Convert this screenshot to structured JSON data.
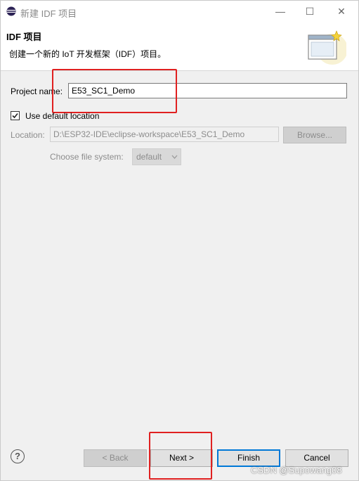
{
  "window": {
    "title": "新建 IDF 项目",
    "controls": {
      "minimize": "—",
      "maximize": "☐",
      "close": "✕"
    }
  },
  "header": {
    "title": "IDF 项目",
    "description": "创建一个新的 IoT 开发框架（IDF）项目。"
  },
  "form": {
    "project_name_label": "Project name:",
    "project_name_value": "E53_SC1_Demo",
    "use_default_location_label": "Use default location",
    "use_default_location_checked": true,
    "location_label": "Location:",
    "location_value": "D:\\ESP32-IDE\\eclipse-workspace\\E53_SC1_Demo",
    "browse_label": "Browse...",
    "file_system_label": "Choose file system:",
    "file_system_value": "default"
  },
  "footer": {
    "help_label": "?",
    "back_label": "< Back",
    "next_label": "Next >",
    "finish_label": "Finish",
    "cancel_label": "Cancel"
  },
  "watermark": "CSDN @Supowang08",
  "colors": {
    "highlight_box": "#e02020",
    "default_button_border": "#0078d7"
  }
}
